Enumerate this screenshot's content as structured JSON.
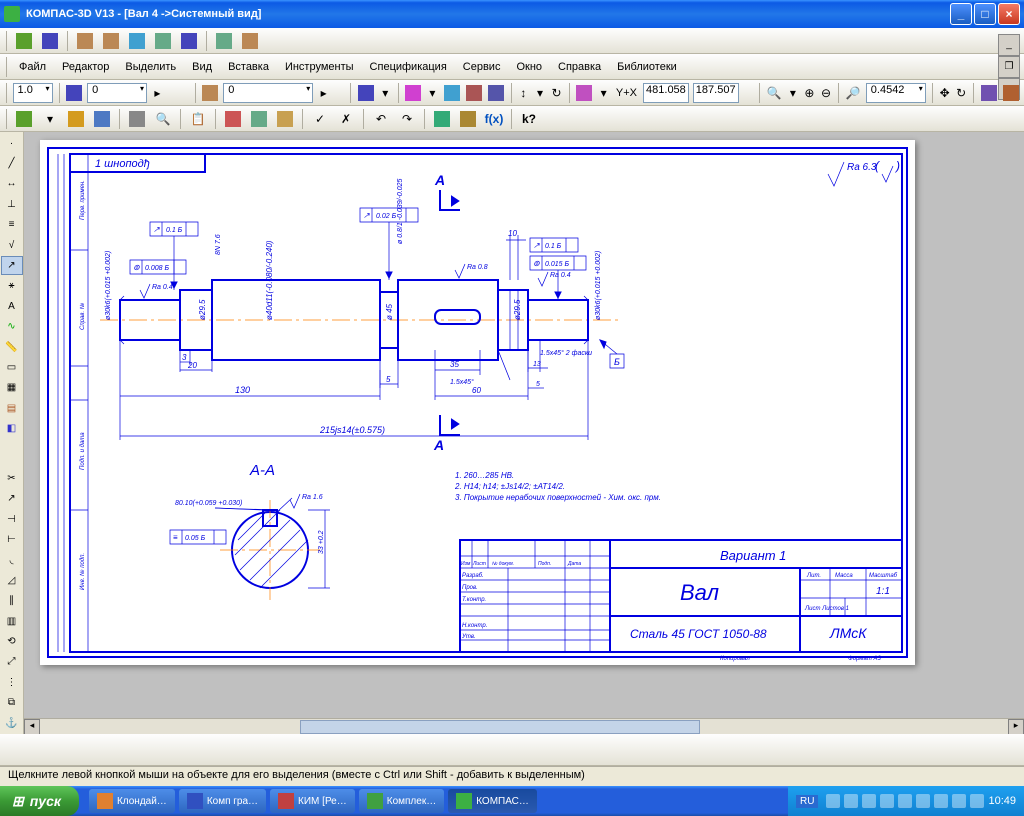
{
  "title": "КОМПАС-3D V13 - [Вал 4 ->Системный вид]",
  "menu": [
    "Файл",
    "Редактор",
    "Выделить",
    "Вид",
    "Вставка",
    "Инструменты",
    "Спецификация",
    "Сервис",
    "Окно",
    "Справка",
    "Библиотеки"
  ],
  "scale_value": "1.0",
  "zero_value": "0",
  "layer_value": "0",
  "coord_x_label": "Y+X",
  "coord_x": "481.058",
  "coord_y": "187.507",
  "zoom_value": "0.4542",
  "status_text": "Щелкните левой кнопкой мыши на объекте для его выделения (вместе с Ctrl или Shift - добавить к выделенным)",
  "start_label": "пуск",
  "task_items": [
    "Клондай…",
    "Комп гра…",
    "КИМ [Ре…",
    "Комплек…",
    "КОМПАС…"
  ],
  "lang": "RU",
  "clock": "10:49",
  "drawing": {
    "frame_label": "1 шноподђ",
    "surface_note": "Ra 6.3",
    "section_marks": "А",
    "section_title": "А-А",
    "tol_01_b": "0.1  Б",
    "tol_002_b": "0.02  Б",
    "tol_008_b": "0.008  Б",
    "tol_005_b": "0.05  Б",
    "tol_0015_b": "0.015  Б",
    "ra04": "Ra 0.4",
    "ra08": "Ra 0.8",
    "ra16": "Ra 1.6",
    "dim_3": "3",
    "dim_5": "5",
    "dim_10": "10",
    "dim_13": "13",
    "dim_20": "20",
    "dim_35": "35",
    "dim_60": "60",
    "dim_130": "130",
    "dim_215": "215js14(±0.575)",
    "dim_45deg": "1.5x45°",
    "dim_45deg2": "1.5x45°\n2 фаски",
    "dim_295": "ø29.5",
    "dim_45": "ø 45",
    "dia_30": "ø30k6(+0.015\n          +0.002)",
    "keyway": "80.10(+0.059\n           +0.030)",
    "notes1": "1. 260…285 HB.",
    "notes2": "2. H14; h14; ±Js14/2; ±AT14/2.",
    "notes3": "3. Покрытие нерабочих поверхностей - Хим. окс. прм.",
    "stamp_variant": "Вариант 1",
    "stamp_name": "Вал",
    "stamp_material": "Сталь 45 ГОСТ 1050-88",
    "stamp_org": "ЛМсК",
    "stamp_scale": "1:1",
    "stamp_format": "Формат   А3",
    "stamp_kopir": "Копировал",
    "stamp_row_izm": "Изм",
    "stamp_row_list": "Лист",
    "stamp_row_num": "№ докум.",
    "stamp_row_podp": "Подп.",
    "stamp_row_data": "Дата",
    "stamp_razrab": "Разраб.",
    "stamp_prov": "Пров.",
    "stamp_tkontr": "Т.контр.",
    "stamp_nkontr": "Н.контр.",
    "stamp_utv": "Утв.",
    "stamp_lit": "Лит.",
    "stamp_massa": "Масса",
    "stamp_mass_sh": "Масштаб",
    "stamp_listy": "Лист    Листов   1",
    "datum_b": "Б"
  }
}
